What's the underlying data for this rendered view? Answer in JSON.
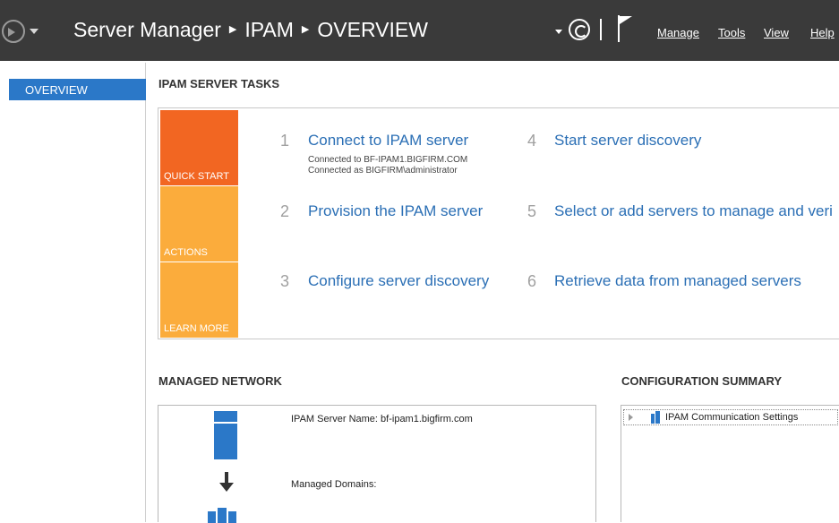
{
  "header": {
    "breadcrumb": [
      "Server Manager",
      "IPAM",
      "OVERVIEW"
    ],
    "menu": [
      "Manage",
      "Tools",
      "View",
      "Help"
    ]
  },
  "sidebar": {
    "items": [
      {
        "label": "OVERVIEW",
        "selected": true
      }
    ]
  },
  "tasks": {
    "title": "IPAM SERVER TASKS",
    "tiles": [
      "QUICK START",
      "ACTIONS",
      "LEARN MORE"
    ],
    "steps": [
      {
        "num": "1",
        "label": "Connect to IPAM server",
        "details": [
          "Connected to BF-IPAM1.BIGFIRM.COM",
          "Connected as BIGFIRM\\administrator"
        ]
      },
      {
        "num": "2",
        "label": "Provision the IPAM server"
      },
      {
        "num": "3",
        "label": "Configure server discovery"
      },
      {
        "num": "4",
        "label": "Start server discovery"
      },
      {
        "num": "5",
        "label": "Select or add servers to manage and veri"
      },
      {
        "num": "6",
        "label": "Retrieve data from managed servers"
      }
    ]
  },
  "managed_network": {
    "title": "MANAGED NETWORK",
    "server_name": "IPAM Server Name: bf-ipam1.bigfirm.com",
    "domains": "Managed Domains:"
  },
  "config_summary": {
    "title": "CONFIGURATION SUMMARY",
    "items": [
      {
        "label": "IPAM Communication Settings"
      }
    ]
  },
  "colors": {
    "titlebar": "#3a3a3a",
    "selected": "#2b78c8",
    "quick_start": "#f26622",
    "tile": "#fbac3c",
    "link": "#2b6fb5"
  },
  "icons": [
    "back-arrow-icon",
    "dropdown-icon",
    "refresh-icon",
    "flag-icon",
    "server-icon",
    "down-arrow-icon",
    "domain-icon",
    "expander-icon",
    "settings-icon"
  ]
}
